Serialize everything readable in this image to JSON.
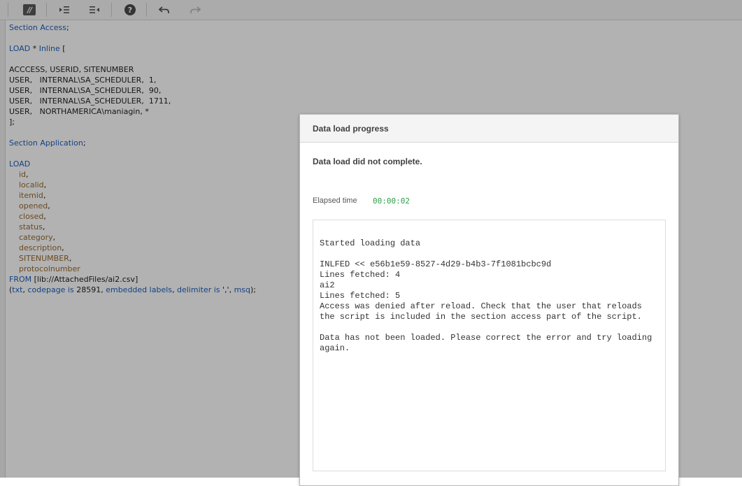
{
  "toolbar": {
    "buttons": [
      {
        "name": "comment-toggle-button",
        "icon": "comment-slash-icon"
      },
      {
        "name": "indent-button",
        "icon": "indent-icon"
      },
      {
        "name": "outdent-button",
        "icon": "outdent-icon"
      },
      {
        "name": "help-button",
        "icon": "help-icon",
        "glyph": "?"
      },
      {
        "name": "undo-button",
        "icon": "undo-icon"
      },
      {
        "name": "redo-button",
        "icon": "redo-icon"
      }
    ],
    "comment_glyph": "//"
  },
  "editor": {
    "lines": [
      [
        {
          "t": "Section Access",
          "c": "kw"
        },
        {
          "t": ";",
          "c": "txt"
        }
      ],
      [],
      [
        {
          "t": "LOAD",
          "c": "kw"
        },
        {
          "t": " * ",
          "c": "txt"
        },
        {
          "t": "Inline",
          "c": "kw"
        },
        {
          "t": " [",
          "c": "txt"
        }
      ],
      [],
      [
        {
          "t": "ACCCESS, USERID, SITENUMBER",
          "c": "txt"
        }
      ],
      [
        {
          "t": "USER,   INTERNAL\\SA_SCHEDULER,  1,",
          "c": "txt"
        }
      ],
      [
        {
          "t": "USER,   INTERNAL\\SA_SCHEDULER,  90,",
          "c": "txt"
        }
      ],
      [
        {
          "t": "USER,   INTERNAL\\SA_SCHEDULER,  1711,",
          "c": "txt"
        }
      ],
      [
        {
          "t": "USER,   NORTHAMERICA\\maniagin, *",
          "c": "txt"
        }
      ],
      [
        {
          "t": "];",
          "c": "txt"
        }
      ],
      [],
      [
        {
          "t": "Section Application",
          "c": "kw"
        },
        {
          "t": ";",
          "c": "txt"
        }
      ],
      [],
      [
        {
          "t": "LOAD",
          "c": "kw"
        }
      ],
      [
        {
          "t": "    ",
          "c": "txt"
        },
        {
          "t": "id",
          "c": "id"
        },
        {
          "t": ",",
          "c": "txt"
        }
      ],
      [
        {
          "t": "    ",
          "c": "txt"
        },
        {
          "t": "localid",
          "c": "id"
        },
        {
          "t": ",",
          "c": "txt"
        }
      ],
      [
        {
          "t": "    ",
          "c": "txt"
        },
        {
          "t": "itemid",
          "c": "id"
        },
        {
          "t": ",",
          "c": "txt"
        }
      ],
      [
        {
          "t": "    ",
          "c": "txt"
        },
        {
          "t": "opened",
          "c": "id"
        },
        {
          "t": ",",
          "c": "txt"
        }
      ],
      [
        {
          "t": "    ",
          "c": "txt"
        },
        {
          "t": "closed",
          "c": "id"
        },
        {
          "t": ",",
          "c": "txt"
        }
      ],
      [
        {
          "t": "    ",
          "c": "txt"
        },
        {
          "t": "status",
          "c": "id"
        },
        {
          "t": ",",
          "c": "txt"
        }
      ],
      [
        {
          "t": "    ",
          "c": "txt"
        },
        {
          "t": "category",
          "c": "id"
        },
        {
          "t": ",",
          "c": "txt"
        }
      ],
      [
        {
          "t": "    ",
          "c": "txt"
        },
        {
          "t": "description",
          "c": "id"
        },
        {
          "t": ",",
          "c": "txt"
        }
      ],
      [
        {
          "t": "    ",
          "c": "txt"
        },
        {
          "t": "SITENUMBER",
          "c": "id"
        },
        {
          "t": ",",
          "c": "txt"
        }
      ],
      [
        {
          "t": "    ",
          "c": "txt"
        },
        {
          "t": "protocolnumber",
          "c": "id"
        }
      ],
      [
        {
          "t": "FROM",
          "c": "kw"
        },
        {
          "t": " [lib://AttachedFiles/ai2.csv]",
          "c": "txt"
        }
      ],
      [
        {
          "t": "(",
          "c": "txt"
        },
        {
          "t": "txt",
          "c": "kw"
        },
        {
          "t": ", ",
          "c": "txt"
        },
        {
          "t": "codepage is",
          "c": "kw"
        },
        {
          "t": " 28591, ",
          "c": "txt"
        },
        {
          "t": "embedded labels",
          "c": "kw"
        },
        {
          "t": ", ",
          "c": "txt"
        },
        {
          "t": "delimiter is",
          "c": "kw"
        },
        {
          "t": " ',', ",
          "c": "txt"
        },
        {
          "t": "msq",
          "c": "kw"
        },
        {
          "t": ");",
          "c": "txt"
        }
      ]
    ]
  },
  "dialog": {
    "title": "Data load progress",
    "status": "Data load did not complete.",
    "elapsed_label": "Elapsed time",
    "elapsed_value": "00:00:02",
    "log_lines": [
      "Started loading data",
      "",
      "INLFED << e56b1e59-8527-4d29-b4b3-7f1081bcbc9d",
      "Lines fetched: 4",
      "ai2",
      "Lines fetched: 5",
      "Access was denied after reload. Check that the user that reloads the script is included in the section access part of the script.",
      "",
      "Data has not been loaded. Please correct the error and try loading again."
    ]
  },
  "colors": {
    "keyword": "#1f5fbd",
    "identifier": "#9a6b2e",
    "elapsed": "#2e9d4a"
  }
}
